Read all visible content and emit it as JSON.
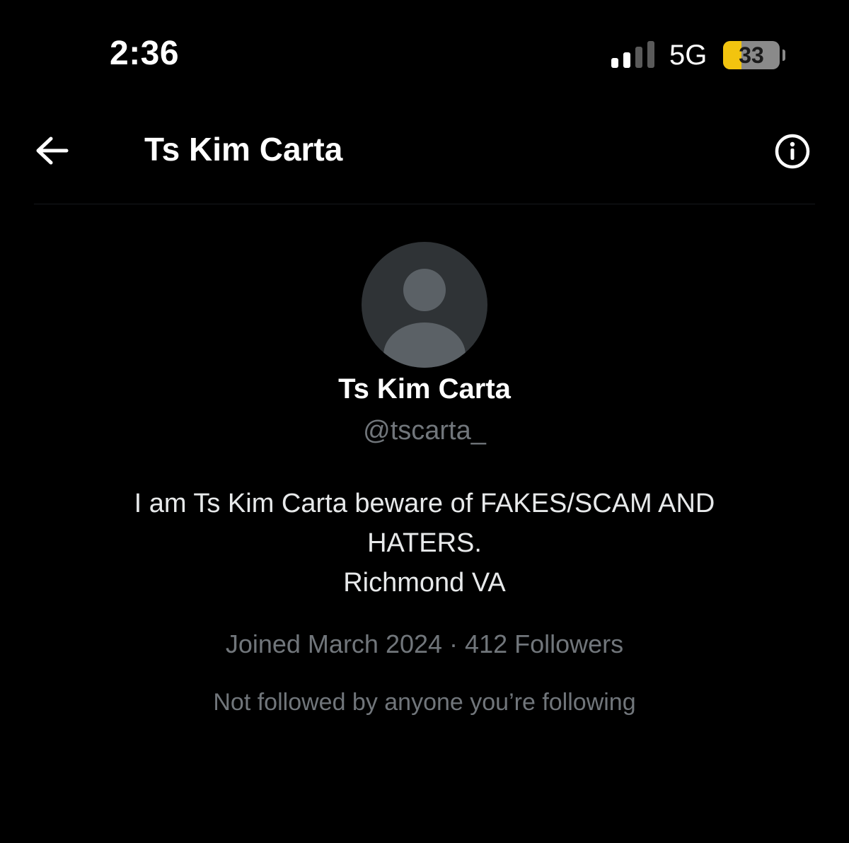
{
  "status_bar": {
    "time": "2:36",
    "network": "5G",
    "battery_level": "33",
    "battery_fraction": 0.33,
    "signal_bars_active": 2,
    "signal_bars_total": 4
  },
  "header": {
    "back_icon": "arrow-left-icon",
    "title": "Ts Kim Carta",
    "info_icon": "info-circle-icon"
  },
  "profile": {
    "avatar": "placeholder",
    "name": "Ts Kim Carta",
    "handle": "@tscarta_",
    "bio_lines": [
      "I am Ts Kim Carta beware of FAKES/SCAM AND",
      "HATERS.",
      "Richmond VA"
    ],
    "joined": "Joined March 2024",
    "separator": " · ",
    "followers": "412 Followers",
    "mutuals": "Not followed by anyone you’re following"
  },
  "colors": {
    "background": "#000000",
    "text_primary": "#ffffff",
    "text_secondary": "#71767b",
    "battery_accent": "#f2c40f"
  }
}
